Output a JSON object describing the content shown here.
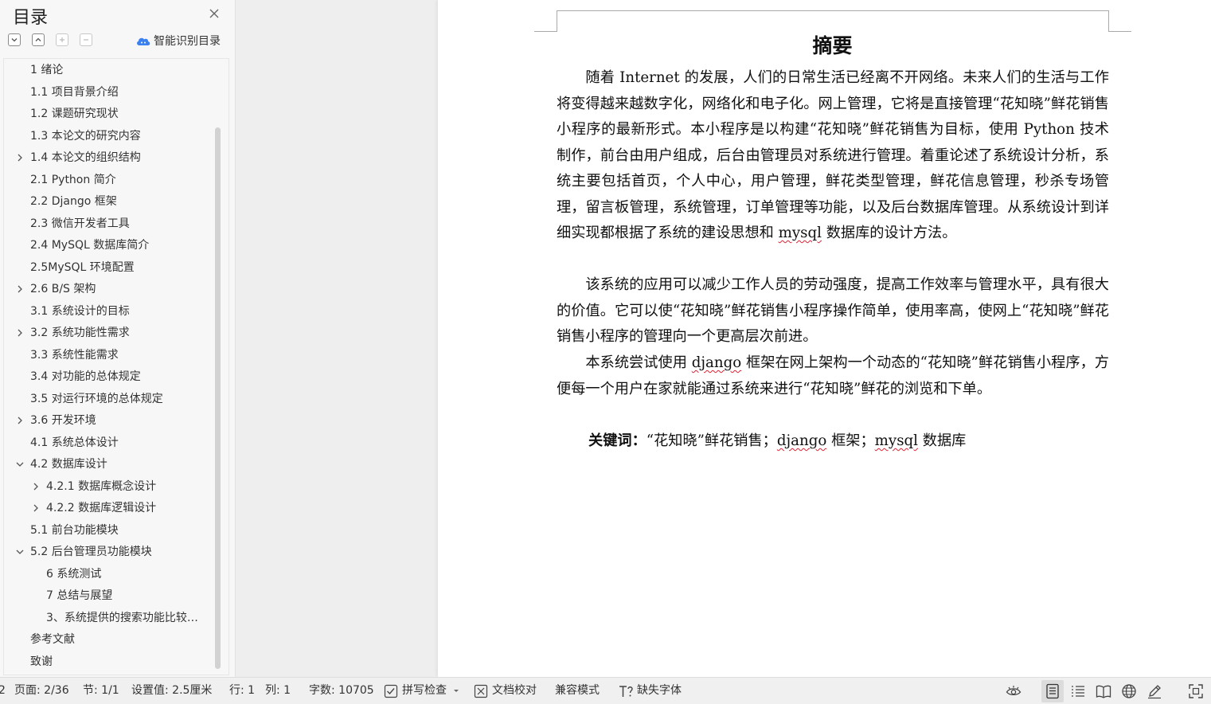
{
  "toc": {
    "title": "目录",
    "smart_toc_label": "智能识别目录",
    "items": [
      {
        "label": "1  绪论",
        "level": 1,
        "expander": "none"
      },
      {
        "label": "1.1 项目背景介绍",
        "level": 1,
        "expander": "none"
      },
      {
        "label": "1.2 课题研究现状",
        "level": 1,
        "expander": "none"
      },
      {
        "label": "1.3 本论文的研究内容",
        "level": 1,
        "expander": "none"
      },
      {
        "label": "1.4 本论文的组织结构",
        "level": 1,
        "expander": "collapsed"
      },
      {
        "label": "2.1 Python 简介",
        "level": 1,
        "expander": "none"
      },
      {
        "label": "2.2 Django 框架",
        "level": 1,
        "expander": "none"
      },
      {
        "label": "2.3 微信开发者工具",
        "level": 1,
        "expander": "none"
      },
      {
        "label": "2.4 MySQL 数据库简介",
        "level": 1,
        "expander": "none"
      },
      {
        "label": "2.5MySQL 环境配置",
        "level": 1,
        "expander": "none"
      },
      {
        "label": "2.6 B/S 架构",
        "level": 1,
        "expander": "collapsed"
      },
      {
        "label": "3.1 系统设计的目标",
        "level": 1,
        "expander": "none"
      },
      {
        "label": "3.2 系统功能性需求",
        "level": 1,
        "expander": "collapsed"
      },
      {
        "label": "3.3 系统性能需求",
        "level": 1,
        "expander": "none"
      },
      {
        "label": "3.4 对功能的总体规定",
        "level": 1,
        "expander": "none"
      },
      {
        "label": "3.5 对运行环境的总体规定",
        "level": 1,
        "expander": "none"
      },
      {
        "label": "3.6 开发环境",
        "level": 1,
        "expander": "collapsed"
      },
      {
        "label": "4.1 系统总体设计",
        "level": 1,
        "expander": "none"
      },
      {
        "label": "4.2 数据库设计",
        "level": 1,
        "expander": "expanded"
      },
      {
        "label": "4.2.1  数据库概念设计",
        "level": 2,
        "expander": "collapsed"
      },
      {
        "label": "4.2.2  数据库逻辑设计",
        "level": 2,
        "expander": "collapsed"
      },
      {
        "label": "5.1 前台功能模块",
        "level": 1,
        "expander": "none"
      },
      {
        "label": "5.2 后台管理员功能模块",
        "level": 1,
        "expander": "expanded"
      },
      {
        "label": "6 系统测试",
        "level": 2,
        "expander": "none"
      },
      {
        "label": "7 总结与展望",
        "level": 2,
        "expander": "none"
      },
      {
        "label": "3、系统提供的搜索功能比较…",
        "level": 2,
        "expander": "none"
      },
      {
        "label": "参考文献",
        "level": 1,
        "expander": "none"
      },
      {
        "label": "致谢",
        "level": 1,
        "expander": "none"
      }
    ]
  },
  "document": {
    "title": "摘要",
    "p1": {
      "a": "随着 Internet 的发展，人们的日常生活已经离不开网络。未来人们的生活与工作将变得越来越数字化，网络化和电子化。网上管理，它将是直接管理“花知晓”鲜花销售小程序的最新形式。本小程序是以构建“花知晓”鲜花销售为目标，使用 Python 技术制作，前台由用户组成，后台由管理员对系统进行管理。着重论述了系统设计分析，系统主要包括首页，个人中心，用户管理，鲜花类型管理，鲜花信息管理，秒杀专场管理，留言板管理，系统管理，订单管理等功能，以及后台数据库管理。从系统设计到详细实现都根据了系统的建设思想和 ",
      "b": "mysql",
      "c": " 数据库的设计方法。"
    },
    "p2": "该系统的应用可以减少工作人员的劳动强度，提高工作效率与管理水平，具有很大的价值。它可以使“花知晓”鲜花销售小程序操作简单，使用率高，使网上“花知晓”鲜花销售小程序的管理向一个更高层次前进。",
    "p3": {
      "a": "本系统尝试使用 ",
      "b": "django",
      "c": " 框架在网上架构一个动态的“花知晓”鲜花销售小程序，方便每一个用户在家就能通过系统来进行“花知晓”鲜花的浏览和下单。"
    },
    "keywords": {
      "label": "关键词：",
      "a": "“花知晓”鲜花销售；",
      "b": "django",
      "c": " 框架；",
      "d": "mysql",
      "e": " 数据库"
    }
  },
  "status_bar": {
    "left_fragment": "2",
    "page": "页面: 2/36",
    "section": "节: 1/1",
    "setting": "设置值: 2.5厘米",
    "row": "行: 1",
    "col": "列: 1",
    "word_count": "字数: 10705",
    "spell_check": "拼写检查",
    "doc_proof": "文档校对",
    "compat_mode": "兼容模式",
    "missing_font": "缺失字体",
    "icons": [
      "eye-protection-icon",
      "page-view-icon",
      "outline-view-icon",
      "reading-view-icon",
      "web-view-icon",
      "writing-mode-icon",
      "fullscreen-icon"
    ],
    "active_view": "page-view-icon"
  },
  "colors": {
    "accent_blue": "#2f7ae5",
    "spellcheck_red": "#dd2233",
    "active_view_bg": "#dcdcdc"
  }
}
